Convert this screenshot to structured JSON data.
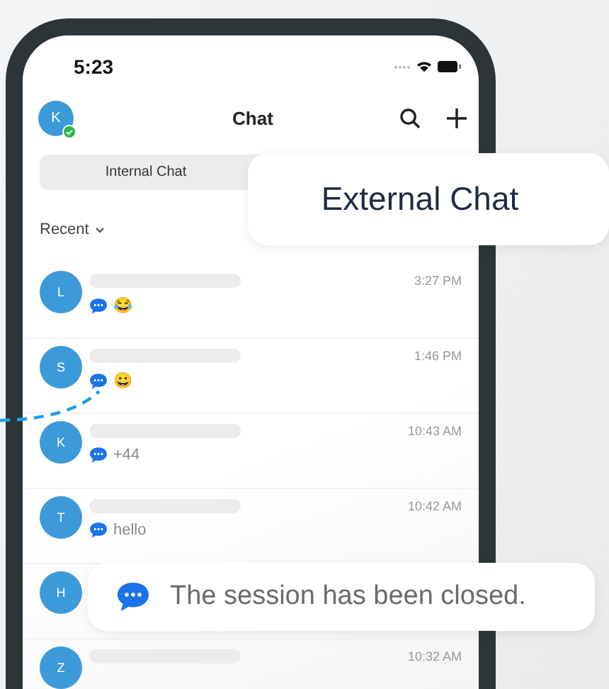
{
  "status_bar": {
    "time": "5:23"
  },
  "header": {
    "avatar_initial": "K",
    "online": true,
    "title": "Chat"
  },
  "tabs": [
    {
      "label": "Internal Chat",
      "selected": false
    }
  ],
  "filter": {
    "label": "Recent"
  },
  "chats": [
    {
      "initial": "L",
      "time": "3:27 PM",
      "preview": "😂"
    },
    {
      "initial": "S",
      "time": "1:46 PM",
      "preview": "😀"
    },
    {
      "initial": "K",
      "time": "10:43 AM",
      "preview": "+44"
    },
    {
      "initial": "T",
      "time": "10:42 AM",
      "preview": "hello"
    },
    {
      "initial": "H"
    },
    {
      "initial": "Z",
      "time": "10:32 AM"
    }
  ],
  "callouts": {
    "tab_label": "External Chat",
    "message": "The session has been closed."
  }
}
